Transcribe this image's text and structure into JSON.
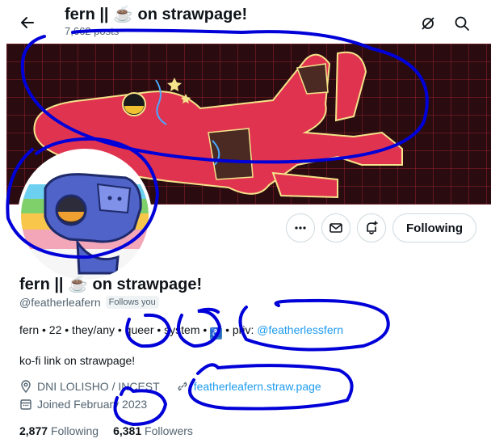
{
  "header": {
    "title": "fern || ☕ on strawpage!",
    "post_count": "7,662 posts"
  },
  "profile": {
    "name": "fern || ☕ on strawpage!",
    "handle": "@featherleafern",
    "follows_you": "Follows you",
    "bio": {
      "part1": "fern • 22 • they/any",
      "word_queer": "queer",
      "sep": "•",
      "word_system": "system",
      "access_symbol": "♿",
      "priv_label": "priv:",
      "priv_handle": "@featherlessfern"
    },
    "bio_line2": "ko-fi link on strawpage!",
    "location": "DNI LOLISHO / INCEST",
    "website": "featherleafern.straw.page",
    "joined": "Joined February 2023",
    "following_count": "2,877",
    "following_label": "Following",
    "followers_count": "6,381",
    "followers_label": "Followers"
  },
  "actions": {
    "following_button": "Following"
  },
  "colors": {
    "link": "#1d9bf0",
    "secondary_text": "#536471",
    "annotation": "#0000d8",
    "banner_bg": "#2a0c10",
    "character_red": "#e0334f"
  }
}
